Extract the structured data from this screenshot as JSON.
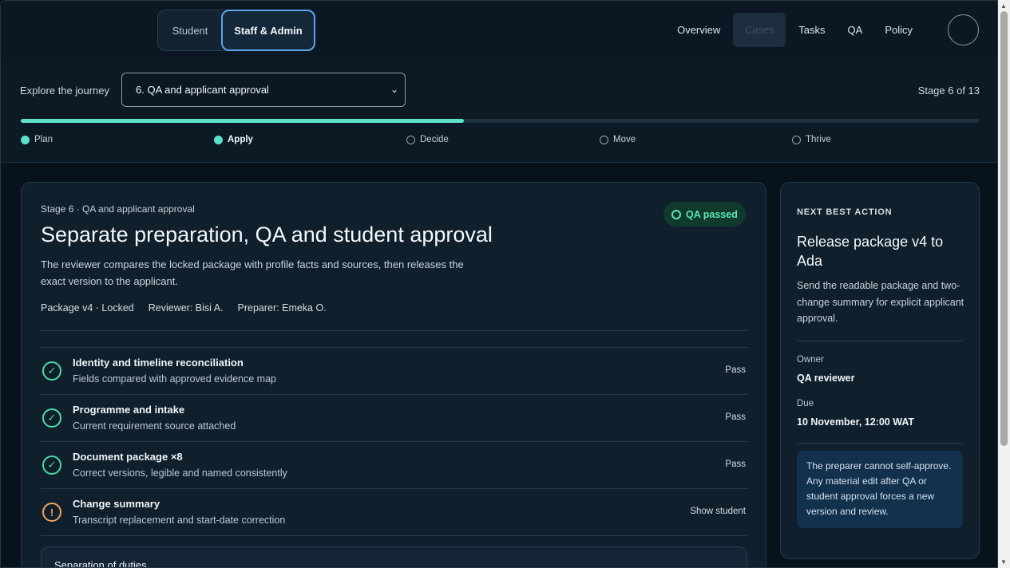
{
  "topbar": {
    "segments": {
      "student": "Student",
      "staff": "Staff & Admin"
    },
    "nav": [
      "Overview",
      "Cases",
      "Tasks",
      "QA",
      "Policy"
    ],
    "active_nav": "Cases"
  },
  "journey": {
    "explore_label": "Explore the journey",
    "selected_stage": "6. QA and applicant approval",
    "stage_count": "Stage 6 of 13",
    "progress_fraction": 0.4625,
    "phases": [
      {
        "label": "Plan",
        "state": "done"
      },
      {
        "label": "Apply",
        "state": "current"
      },
      {
        "label": "Decide",
        "state": "upcoming"
      },
      {
        "label": "Move",
        "state": "upcoming"
      },
      {
        "label": "Thrive",
        "state": "upcoming"
      }
    ]
  },
  "main": {
    "eyebrow": "Stage 6 · QA and applicant approval",
    "badge": "QA passed",
    "title": "Separate preparation, QA and student approval",
    "description": "The reviewer compares the locked package with profile facts and sources, then releases the exact version to the applicant.",
    "meta": {
      "package": "Package v4 · Locked",
      "reviewer": "Reviewer: Bisi A.",
      "preparer": "Preparer: Emeka O."
    },
    "checks": [
      {
        "title": "Identity and timeline reconciliation",
        "sub": "Fields compared with approved evidence map",
        "status": "Pass",
        "icon": "check"
      },
      {
        "title": "Programme and intake",
        "sub": "Current requirement source attached",
        "status": "Pass",
        "icon": "check"
      },
      {
        "title": "Document package ×8",
        "sub": "Correct versions, legible and named consistently",
        "status": "Pass",
        "icon": "check"
      },
      {
        "title": "Change summary",
        "sub": "Transcript replacement and start-date correction",
        "status": "Show student",
        "icon": "!"
      }
    ],
    "separation_title": "Separation of duties"
  },
  "side": {
    "eyebrow": "NEXT BEST ACTION",
    "title": "Release package v4 to Ada",
    "description": "Send the readable package and two-change summary for explicit applicant approval.",
    "owner_label": "Owner",
    "owner_value": "QA reviewer",
    "due_label": "Due",
    "due_value": "10 November, 12:00 WAT",
    "notice": "The preparer cannot self-approve. Any material edit after QA or student approval forces a new version and review."
  },
  "colors": {
    "accent": "#5fe0c8",
    "pass": "#4fd9a3",
    "warn": "#f2a25a",
    "focus": "#5fa3ea"
  }
}
